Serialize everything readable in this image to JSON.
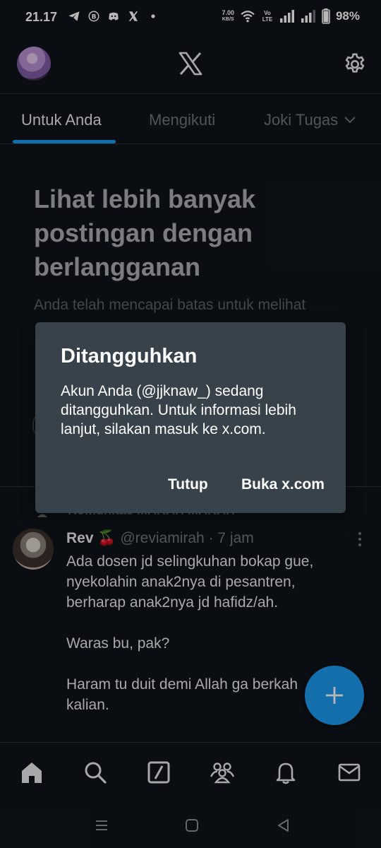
{
  "status_bar": {
    "time": "21.17",
    "network_speed_value": "7.00",
    "network_speed_unit": "KB/S",
    "volte": "Vo LTE",
    "battery": "98%",
    "icons": [
      "telegram-icon",
      "b-badge-icon",
      "discord-icon",
      "x-icon",
      "dot-icon",
      "wifi-icon",
      "signal-icon",
      "signal-icon-2",
      "battery-icon"
    ]
  },
  "header": {
    "logo": "X",
    "settings_icon": "gear-icon"
  },
  "tabs": [
    {
      "label": "Untuk Anda",
      "active": true
    },
    {
      "label": "Mengikuti",
      "active": false
    },
    {
      "label": "Joki Tugas",
      "active": false
    }
  ],
  "upsell": {
    "title": "Lihat lebih banyak postingan dengan berlangganan",
    "subtitle": "Anda telah mencapai batas untuk melihat"
  },
  "community_label": "Komunitas MARAH MARAH",
  "tweet": {
    "name": "Rev 🍒",
    "handle": "@reviamirah",
    "time": "· 7 jam",
    "lines": [
      "Ada dosen jd selingkuhan bokap gue,",
      "nyekolahin anak2nya di pesantren,",
      "berharap anak2nya jd hafidz/ah.",
      "",
      "Waras bu, pak?",
      "",
      "Haram tu duit demi Allah ga berkah",
      "kalian."
    ]
  },
  "dialog": {
    "title": "Ditangguhkan",
    "body": "Akun Anda (@jjknaw_) sedang ditangguhkan. Untuk informasi lebih lanjut, silakan masuk ke x.com.",
    "close_label": "Tutup",
    "open_label": "Buka x.com"
  },
  "bottom_nav": [
    "home-icon",
    "search-icon",
    "grok-icon",
    "communities-icon",
    "notifications-icon",
    "messages-icon"
  ],
  "colors": {
    "background": "#0f1419",
    "accent": "#1d9bf0",
    "dialog": "#37424a",
    "muted_text": "#71767b"
  }
}
